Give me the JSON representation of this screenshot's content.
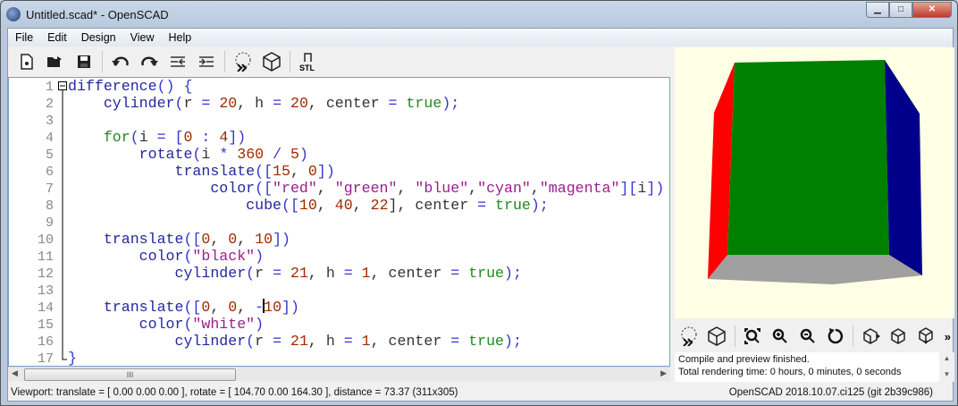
{
  "window": {
    "title": "Untitled.scad* - OpenSCAD",
    "minimize": "▁",
    "maximize": "□",
    "close": "✕"
  },
  "menu": [
    "File",
    "Edit",
    "Design",
    "View",
    "Help"
  ],
  "toolbar": {
    "stl_label": "STL"
  },
  "editor": {
    "line_numbers": [
      "1",
      "2",
      "3",
      "4",
      "5",
      "6",
      "7",
      "8",
      "9",
      "10",
      "11",
      "12",
      "13",
      "14",
      "15",
      "16",
      "17"
    ],
    "lines": [
      [
        [
          "difference",
          "kw"
        ],
        [
          "() {",
          "p"
        ]
      ],
      [
        [
          "    cylinder",
          "kw"
        ],
        [
          "(",
          "p"
        ],
        [
          "r",
          "id"
        ],
        [
          " = ",
          "op"
        ],
        [
          "20",
          "num"
        ],
        [
          ", ",
          "id"
        ],
        [
          "h",
          "id"
        ],
        [
          " = ",
          "op"
        ],
        [
          "20",
          "num"
        ],
        [
          ", center ",
          "id"
        ],
        [
          "= ",
          "op"
        ],
        [
          "true",
          "bool"
        ],
        [
          ");",
          "p"
        ]
      ],
      [],
      [
        [
          "    for",
          "bool"
        ],
        [
          "(",
          "p"
        ],
        [
          "i",
          "id"
        ],
        [
          " = [",
          "p"
        ],
        [
          "0",
          "num"
        ],
        [
          " : ",
          "p"
        ],
        [
          "4",
          "num"
        ],
        [
          "])",
          "p"
        ]
      ],
      [
        [
          "        rotate",
          "kw"
        ],
        [
          "(",
          "p"
        ],
        [
          "i",
          "id"
        ],
        [
          " * ",
          "p"
        ],
        [
          "360",
          "num"
        ],
        [
          " / ",
          "p"
        ],
        [
          "5",
          "num"
        ],
        [
          ")",
          "p"
        ]
      ],
      [
        [
          "            translate",
          "kw"
        ],
        [
          "([",
          "p"
        ],
        [
          "15",
          "num"
        ],
        [
          ", ",
          "id"
        ],
        [
          "0",
          "num"
        ],
        [
          "])",
          "p"
        ]
      ],
      [
        [
          "                color",
          "kw"
        ],
        [
          "([",
          "p"
        ],
        [
          "\"red\"",
          "str"
        ],
        [
          ", ",
          "id"
        ],
        [
          "\"green\"",
          "str"
        ],
        [
          ", ",
          "id"
        ],
        [
          "\"blue\"",
          "str"
        ],
        [
          ",",
          "id"
        ],
        [
          "\"cyan\"",
          "str"
        ],
        [
          ",",
          "id"
        ],
        [
          "\"magenta\"",
          "str"
        ],
        [
          "][",
          "p"
        ],
        [
          "i",
          "id"
        ],
        [
          "])",
          "p"
        ]
      ],
      [
        [
          "                    cube",
          "kw"
        ],
        [
          "([",
          "p"
        ],
        [
          "10",
          "num"
        ],
        [
          ", ",
          "id"
        ],
        [
          "40",
          "num"
        ],
        [
          ", ",
          "id"
        ],
        [
          "22",
          "num"
        ],
        [
          "], center ",
          "id"
        ],
        [
          "= ",
          "op"
        ],
        [
          "true",
          "bool"
        ],
        [
          ");",
          "p"
        ]
      ],
      [],
      [
        [
          "    translate",
          "kw"
        ],
        [
          "([",
          "p"
        ],
        [
          "0",
          "num"
        ],
        [
          ", ",
          "id"
        ],
        [
          "0",
          "num"
        ],
        [
          ", ",
          "id"
        ],
        [
          "10",
          "num"
        ],
        [
          "])",
          "p"
        ]
      ],
      [
        [
          "        color",
          "kw"
        ],
        [
          "(",
          "p"
        ],
        [
          "\"black\"",
          "str"
        ],
        [
          ")",
          "p"
        ]
      ],
      [
        [
          "            cylinder",
          "kw"
        ],
        [
          "(",
          "p"
        ],
        [
          "r",
          "id"
        ],
        [
          " = ",
          "op"
        ],
        [
          "21",
          "num"
        ],
        [
          ", ",
          "id"
        ],
        [
          "h",
          "id"
        ],
        [
          " = ",
          "op"
        ],
        [
          "1",
          "num"
        ],
        [
          ", center ",
          "id"
        ],
        [
          "= ",
          "op"
        ],
        [
          "true",
          "bool"
        ],
        [
          ");",
          "p"
        ]
      ],
      [],
      [
        [
          "    translate",
          "kw"
        ],
        [
          "([",
          "p"
        ],
        [
          "0",
          "num"
        ],
        [
          ", ",
          "id"
        ],
        [
          "0",
          "num"
        ],
        [
          ", ",
          "id"
        ],
        [
          "-",
          "p"
        ],
        [
          "|",
          "cursor"
        ],
        [
          "10",
          "num"
        ],
        [
          "])",
          "p"
        ]
      ],
      [
        [
          "        color",
          "kw"
        ],
        [
          "(",
          "p"
        ],
        [
          "\"white\"",
          "str"
        ],
        [
          ")",
          "p"
        ]
      ],
      [
        [
          "            cylinder",
          "kw"
        ],
        [
          "(",
          "p"
        ],
        [
          "r",
          "id"
        ],
        [
          " = ",
          "op"
        ],
        [
          "21",
          "num"
        ],
        [
          ", ",
          "id"
        ],
        [
          "h",
          "id"
        ],
        [
          " = ",
          "op"
        ],
        [
          "1",
          "num"
        ],
        [
          ", center ",
          "id"
        ],
        [
          "= ",
          "op"
        ],
        [
          "true",
          "bool"
        ],
        [
          ");",
          "p"
        ]
      ],
      [
        [
          "}",
          "p"
        ]
      ]
    ]
  },
  "scrollbar": {
    "grip": "III",
    "left": "◀",
    "right": "▶"
  },
  "console": {
    "line1": "Compile and preview finished.",
    "line2": "Total rendering time: 0 hours, 0 minutes, 0 seconds",
    "up": "▲",
    "down": "▼"
  },
  "view_toolbar": {
    "more": "»"
  },
  "status": {
    "viewport": "Viewport: translate = [ 0.00 0.00 0.00 ], rotate = [ 104.70 0.00 164.30 ], distance = 73.37 (311x305)",
    "version": "OpenSCAD 2018.10.07.ci125 (git 2b39c986)"
  },
  "colors": {
    "viewport_bg": "#ffffe5",
    "red": "#ff0000",
    "green": "#008000",
    "blue": "#00008b",
    "gray": "#a0a0a0"
  }
}
